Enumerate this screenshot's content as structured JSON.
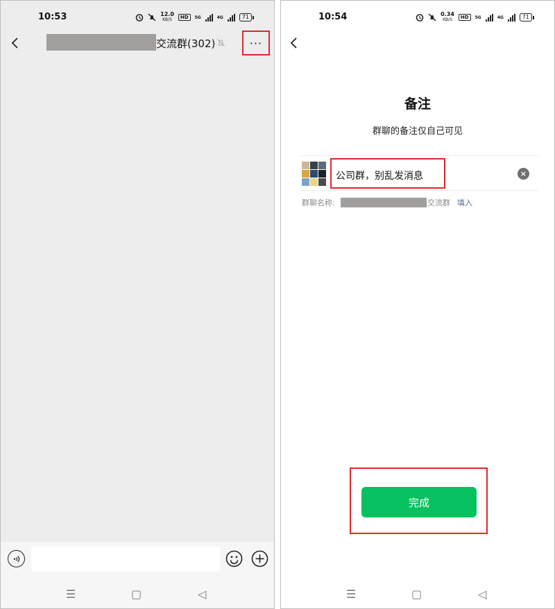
{
  "left_screen": {
    "status_bar": {
      "time": "10:53",
      "net_speed_value": "12.0",
      "net_speed_unit": "KB/S",
      "hd_label": "HD",
      "signal_label_1": "5G",
      "signal_label_2": "4G",
      "battery": "71"
    },
    "header": {
      "title_suffix": "交流群(302)",
      "more_label": "···",
      "back_icon": "chevron-left-icon",
      "mute_icon": "bell-off-icon"
    },
    "input_bar": {
      "voice_icon": "voice-icon",
      "emoji_icon": "smile-icon",
      "plus_icon": "plus-circle-icon"
    }
  },
  "right_screen": {
    "status_bar": {
      "time": "10:54",
      "net_speed_value": "0.34",
      "net_speed_unit": "KB/S",
      "hd_label": "HD",
      "signal_label_1": "5G",
      "signal_label_2": "4G",
      "battery": "71"
    },
    "title": "备注",
    "subtitle": "群聊的备注仅自己可见",
    "remark_value": "公司群，别乱发消息",
    "clear_label": "×",
    "group_name_label": "群聊名称:",
    "group_name_suffix": "交流群",
    "fill_label": "填入",
    "done_button": "完成"
  },
  "nav_bar": {
    "menu_glyph": "☰",
    "home_glyph": "▢",
    "back_glyph": "◁"
  },
  "colors": {
    "accent_green": "#07c160",
    "highlight_red": "#e0262a",
    "link_blue": "#576b95",
    "chat_background": "#ededed"
  }
}
